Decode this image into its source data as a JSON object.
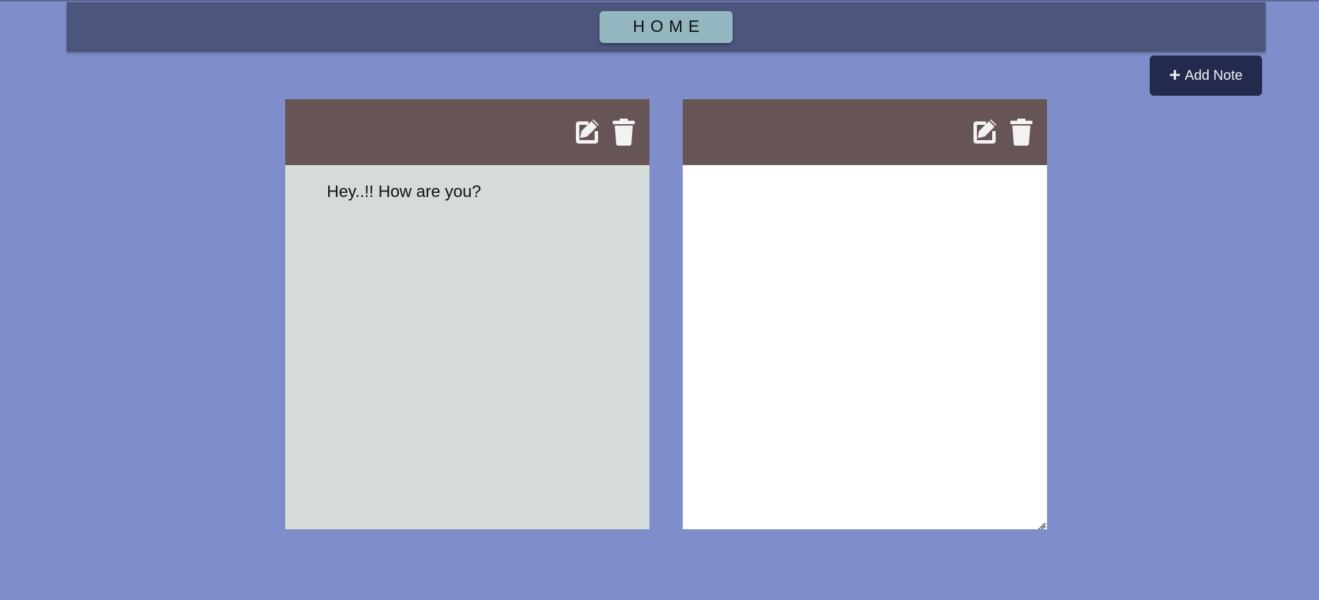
{
  "header": {
    "home_label": "HOME"
  },
  "actions": {
    "add_note_label": "Add Note",
    "add_note_icon": "plus-icon"
  },
  "notes": [
    {
      "text": "Hey..!! How are you?",
      "edit_icon": "edit-icon",
      "delete_icon": "trash-icon"
    },
    {
      "text": "",
      "edit_icon": "edit-icon",
      "delete_icon": "trash-icon"
    }
  ],
  "colors": {
    "background": "#7f8ecb",
    "header": "#4c567c",
    "home_button": "#93b6c1",
    "add_note_button": "#232a4d",
    "note_toolbar": "#665554",
    "note_body_view": "#d4dbd8",
    "note_body_edit": "#ffffff"
  }
}
